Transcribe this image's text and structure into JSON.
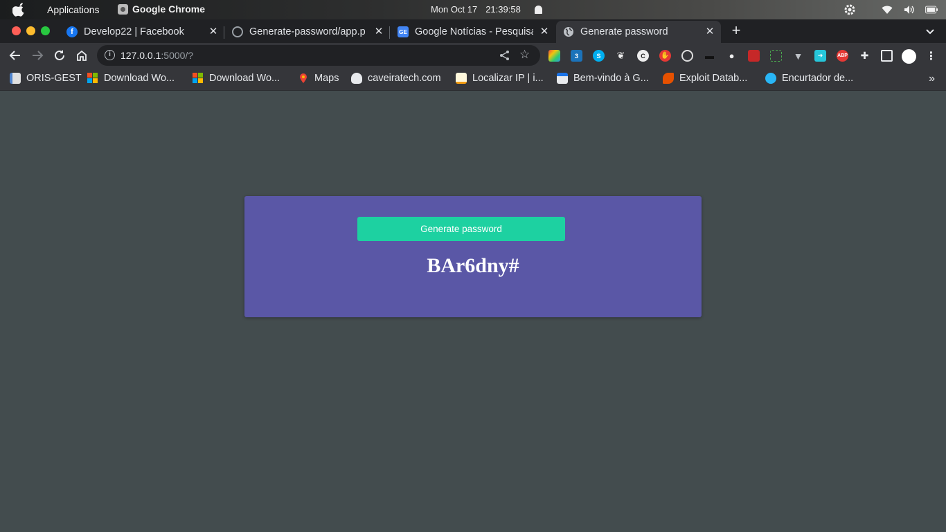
{
  "system": {
    "apps_menu": "Applications",
    "active_app": "Google Chrome",
    "date": "Mon Oct 17",
    "time": "21:39:58"
  },
  "tabs": [
    {
      "title": "Develop22 | Facebook",
      "icon": "facebook-icon",
      "active": false
    },
    {
      "title": "Generate-password/app.p",
      "icon": "github-icon",
      "active": false
    },
    {
      "title": "Google Notícias - Pesquisa",
      "icon": "google-news-icon",
      "active": false
    },
    {
      "title": "Generate password",
      "icon": "globe-icon",
      "active": true
    }
  ],
  "omnibox": {
    "host": "127.0.0.1",
    "path": ":5000/?"
  },
  "bookmarks": [
    {
      "label": "ORIS-GEST",
      "icon": "document-icon"
    },
    {
      "label": "Download Wo...",
      "icon": "microsoft-icon"
    },
    {
      "label": "Download Wo...",
      "icon": "microsoft-icon"
    },
    {
      "label": "Maps",
      "icon": "maps-pin-icon"
    },
    {
      "label": "caveiratech.com",
      "icon": "skull-icon"
    },
    {
      "label": "Localizar IP | i...",
      "icon": "notepad-icon"
    },
    {
      "label": "Bem-vindo à G...",
      "icon": "store-icon"
    },
    {
      "label": "Exploit Datab...",
      "icon": "exploit-db-icon"
    },
    {
      "label": "Encurtador de...",
      "icon": "link-icon"
    }
  ],
  "extensions": {
    "abp_label": "ABP"
  },
  "page": {
    "button_label": "Generate password",
    "password": "BAr6dny#"
  },
  "colors": {
    "page_background": "#434c4e",
    "card_background": "#5a57a6",
    "button_background": "#1dd1a1"
  }
}
